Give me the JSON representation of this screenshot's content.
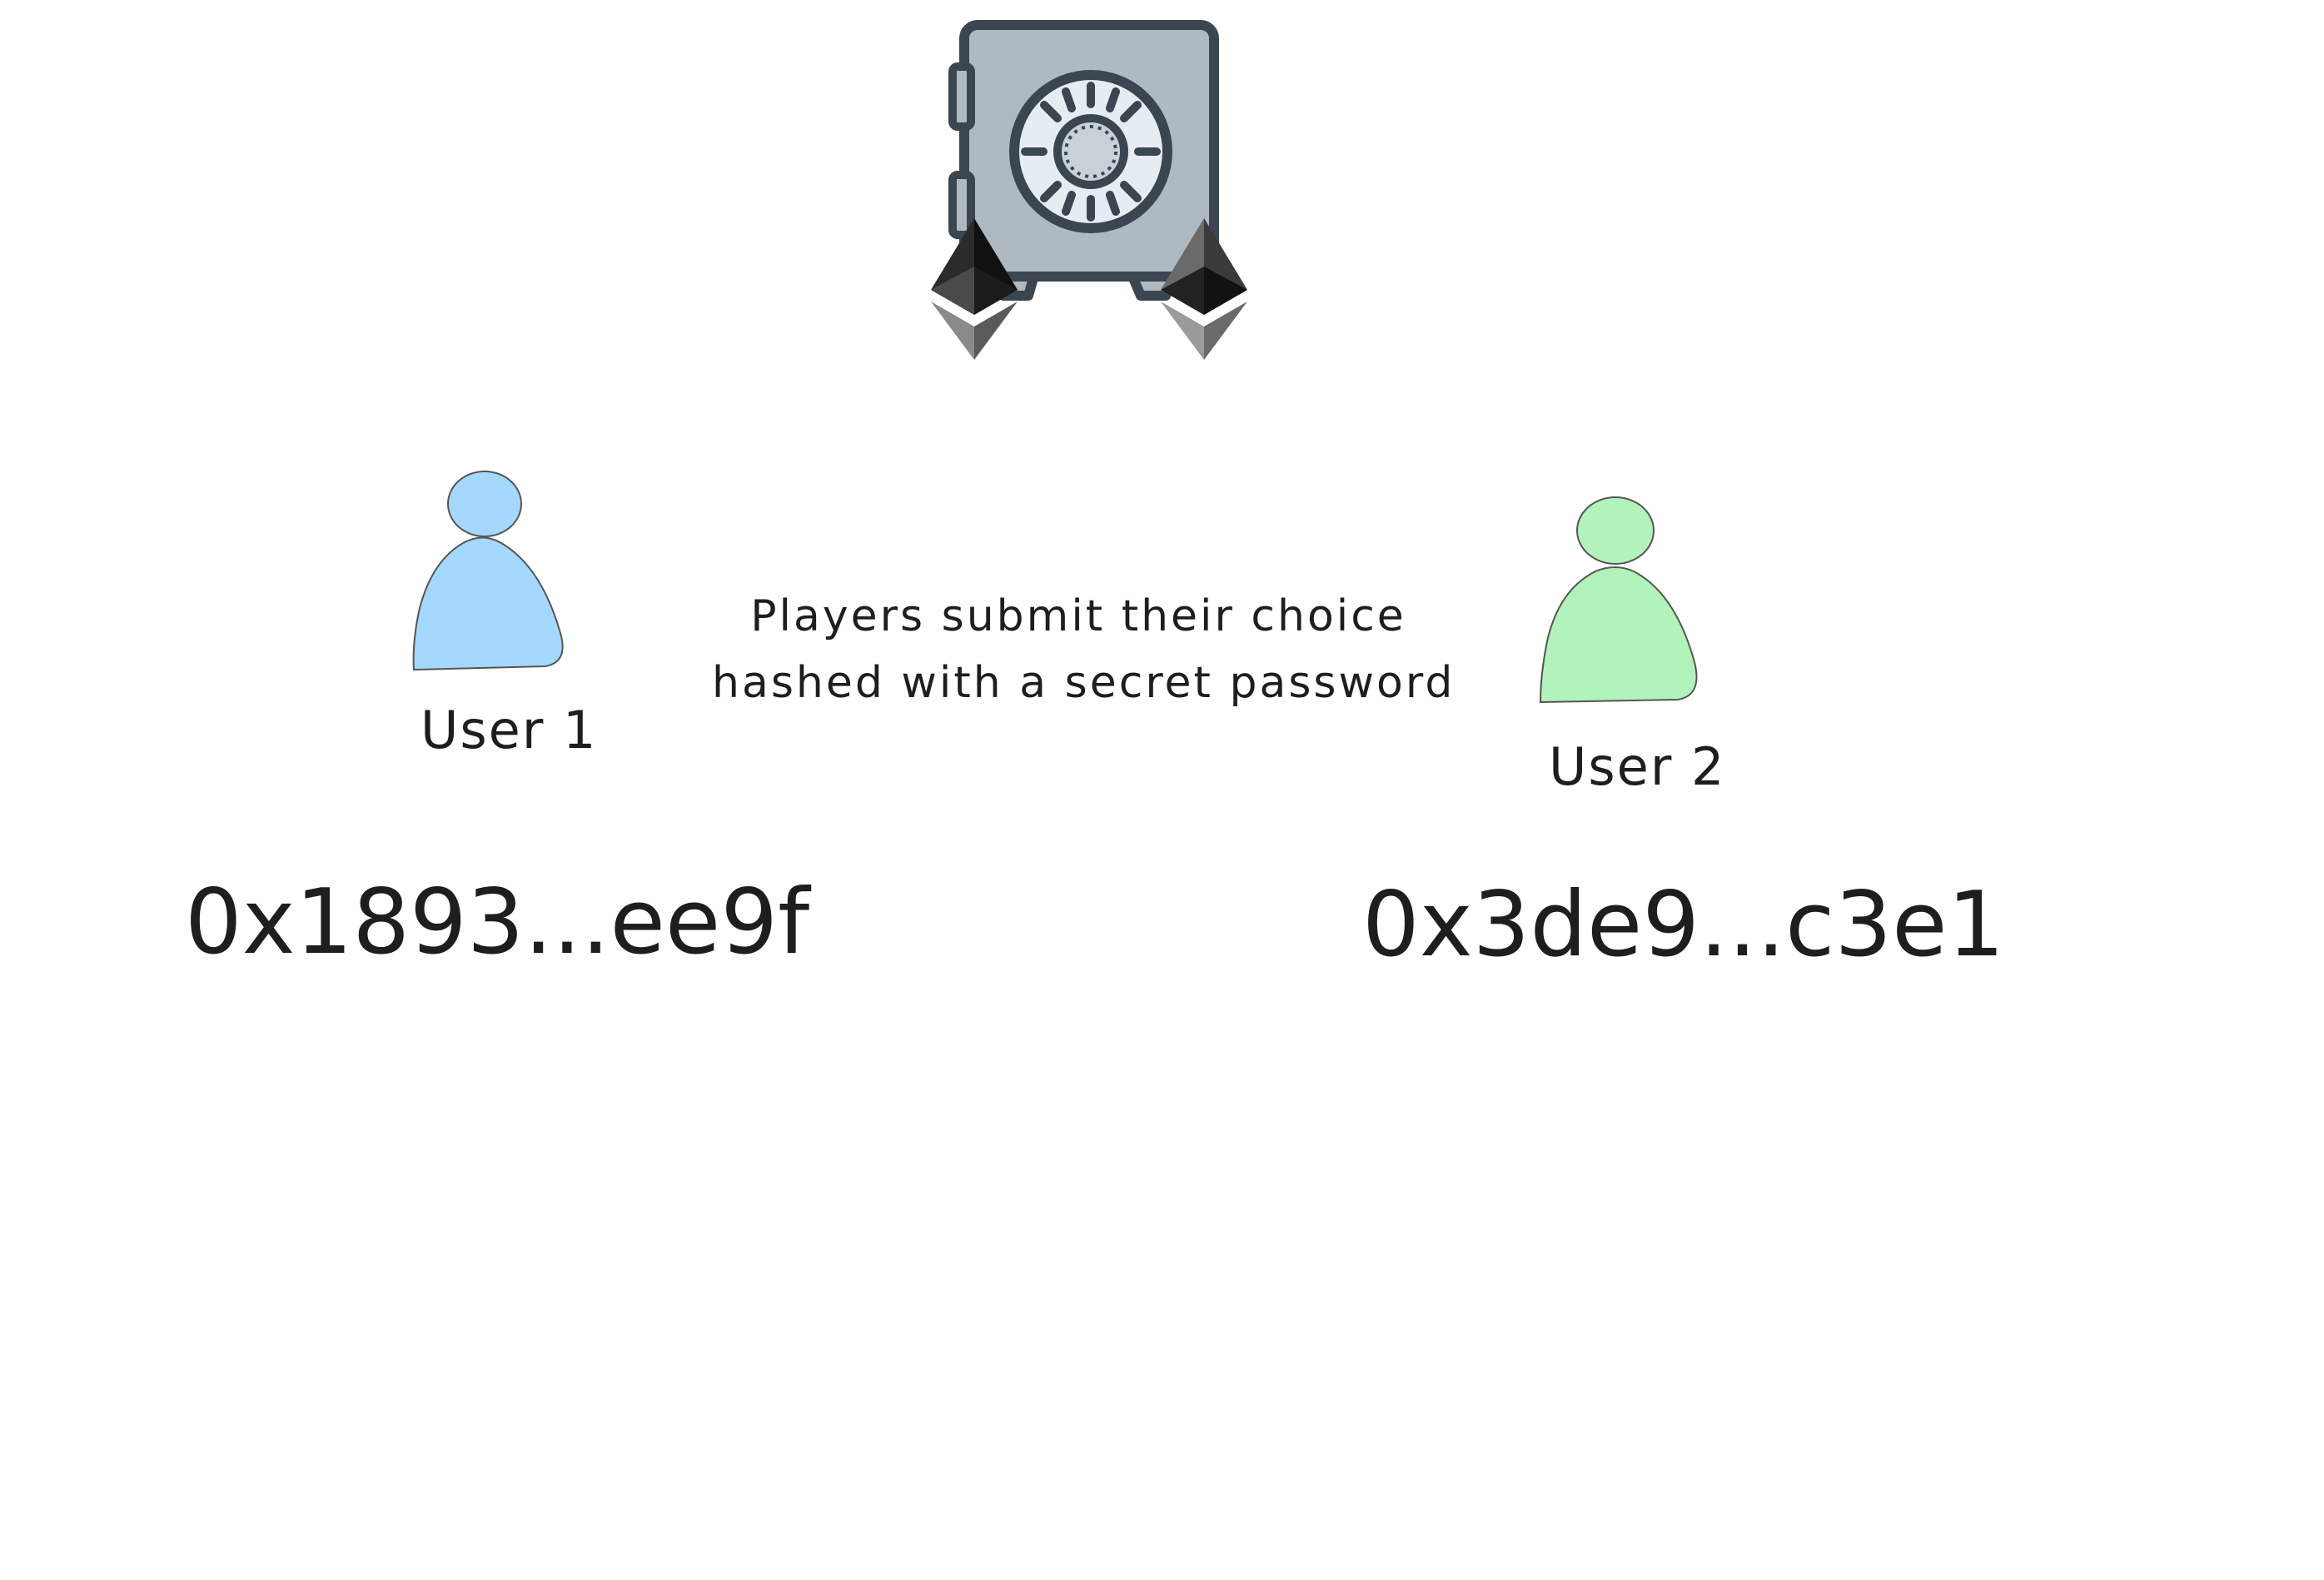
{
  "diagram": {
    "caption_line1": "Players submit their choice",
    "caption_line2": "hashed with a secret password",
    "users": [
      {
        "label": "User 1",
        "address": "0x1893...ee9f",
        "color": "#a5d8ff"
      },
      {
        "label": "User 2",
        "address": "0x3de9...c3e1",
        "color": "#b2f2bb"
      }
    ],
    "vault": {
      "icon": "safe-icon",
      "body_color": "#aeb9c1",
      "outline_color": "#3c4650"
    },
    "tokens": {
      "icon": "ethereum-icon",
      "count": 2
    }
  }
}
